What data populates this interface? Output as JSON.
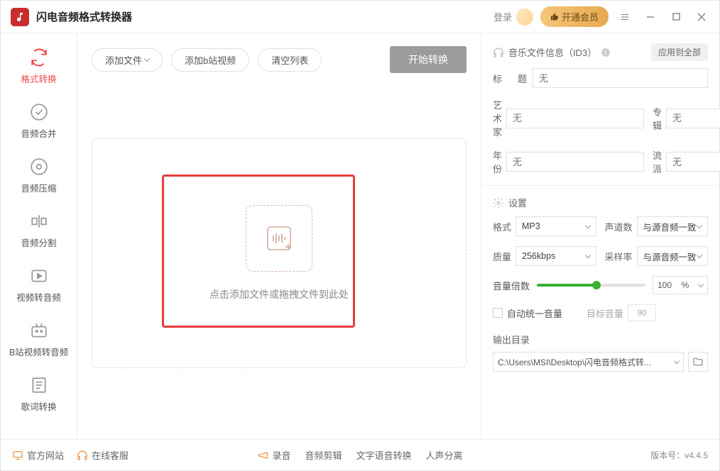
{
  "app": {
    "title": "闪电音频格式转换器"
  },
  "titlebar": {
    "login": "登录",
    "vip": "开通会员"
  },
  "sidebar": {
    "items": [
      {
        "label": "格式转换"
      },
      {
        "label": "音频合并"
      },
      {
        "label": "音频压缩"
      },
      {
        "label": "音频分割"
      },
      {
        "label": "视频转音频"
      },
      {
        "label": "B站视频转音频"
      },
      {
        "label": "歌词转换"
      }
    ]
  },
  "toolbar": {
    "add_file": "添加文件",
    "add_bilibili": "添加b站视频",
    "clear": "清空列表",
    "start": "开始转换"
  },
  "dropzone": {
    "text": "点击添加文件或拖拽文件到此处"
  },
  "id3": {
    "header": "音乐文件信息（ID3）",
    "apply_all": "应用到全部",
    "title_label": "标 题",
    "artist_label": "艺术家",
    "album_label": "专辑",
    "year_label": "年 份",
    "genre_label": "流派",
    "placeholder": "无"
  },
  "settings": {
    "header": "设置",
    "format_label": "格式",
    "format_value": "MP3",
    "channels_label": "声道数",
    "channels_value": "与源音频一致",
    "quality_label": "质量",
    "quality_value": "256kbps",
    "samplerate_label": "采样率",
    "samplerate_value": "与源音频一致",
    "volume_label": "音量倍数",
    "volume_value": "100",
    "volume_unit": "%",
    "normalize_label": "自动统一音量",
    "target_volume_label": "目标音量",
    "target_volume_value": "90",
    "outdir_label": "输出目录",
    "outdir_value": "C:\\Users\\MSI\\Desktop\\闪电音频格式转..."
  },
  "footer": {
    "website": "官方网站",
    "support": "在线客服",
    "record": "录音",
    "trim": "音频剪辑",
    "tts": "文字语音转换",
    "vocal": "人声分离",
    "version_label": "版本号：",
    "version": "v4.4.5"
  }
}
